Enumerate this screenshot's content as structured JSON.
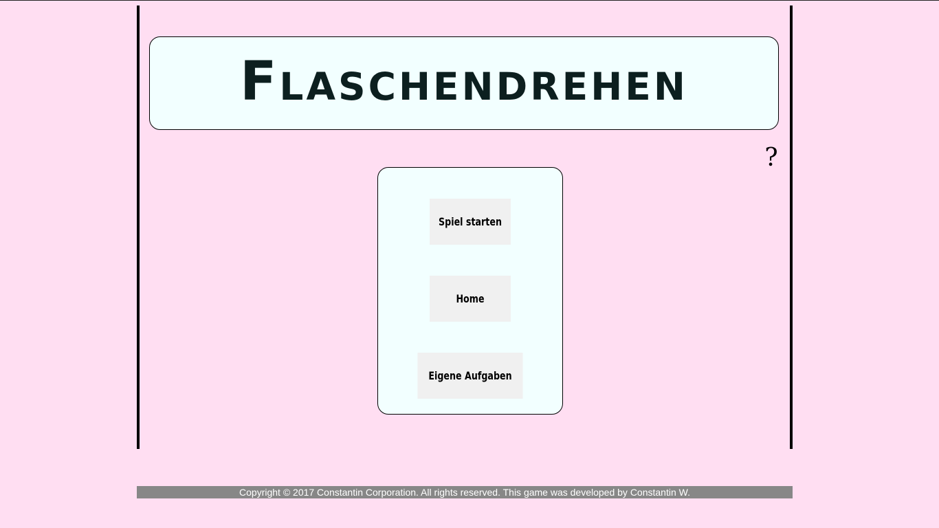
{
  "title": "Flaschendrehen",
  "help": {
    "label": "?"
  },
  "menu": {
    "start_label": "Spiel starten",
    "home_label": "Home",
    "custom_tasks_label": "Eigene Aufgaben"
  },
  "footer": {
    "copyright": "Copyright © 2017 Constantin Corporation. All rights reserved. This game was developed by Constantin W."
  },
  "colors": {
    "background": "#ffdef2",
    "panel": "#f2ffff",
    "button": "#f0f0f0",
    "footer": "#878787",
    "title_text": "#0c1f1f"
  }
}
